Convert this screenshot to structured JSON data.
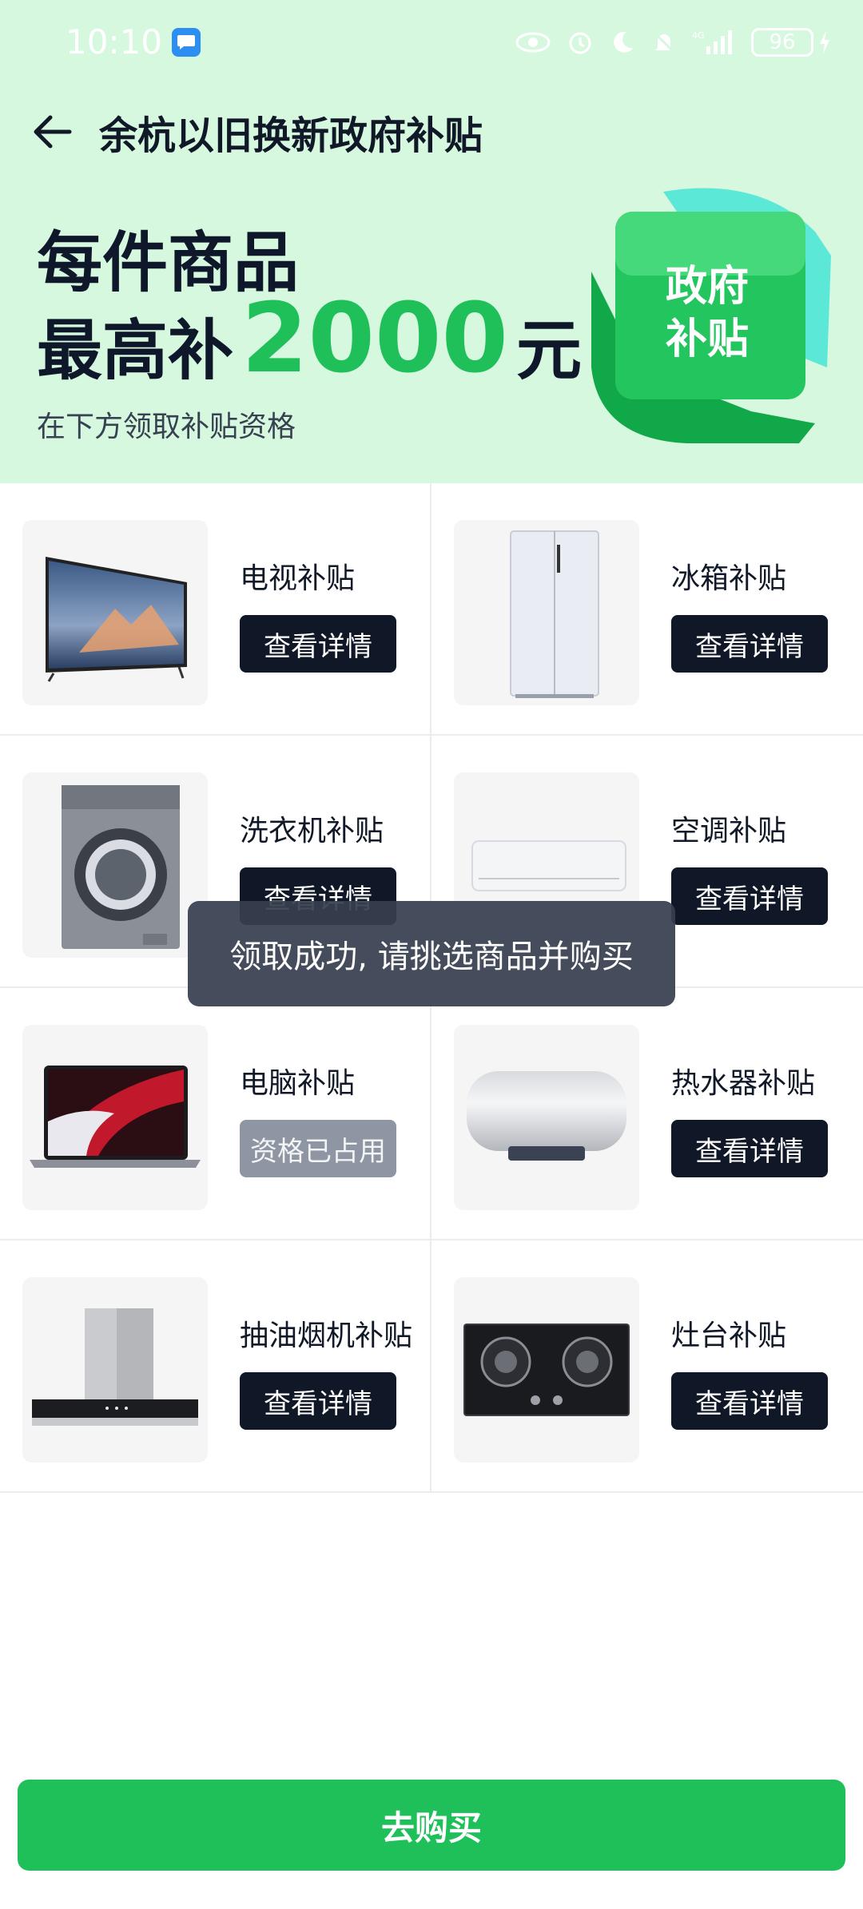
{
  "status_bar": {
    "time": "10:10",
    "network": "4G",
    "battery": "96"
  },
  "header": {
    "title": "余杭以旧换新政府补贴"
  },
  "hero": {
    "line1": "每件商品",
    "line2_prefix": "最高补",
    "amount": "2000",
    "line2_suffix": "元",
    "subtitle": "在下方领取补贴资格",
    "badge_line1": "政府",
    "badge_line2": "补贴"
  },
  "items": [
    {
      "name": "电视补贴",
      "button": "查看详情",
      "state": "active",
      "icon": "tv"
    },
    {
      "name": "冰箱补贴",
      "button": "查看详情",
      "state": "active",
      "icon": "fridge"
    },
    {
      "name": "洗衣机补贴",
      "button": "查看详情",
      "state": "active",
      "icon": "washing-machine"
    },
    {
      "name": "空调补贴",
      "button": "查看详情",
      "state": "active",
      "icon": "air-conditioner"
    },
    {
      "name": "电脑补贴",
      "button": "资格已占用",
      "state": "disabled",
      "icon": "laptop"
    },
    {
      "name": "热水器补贴",
      "button": "查看详情",
      "state": "active",
      "icon": "water-heater"
    },
    {
      "name": "抽油烟机补贴",
      "button": "查看详情",
      "state": "active",
      "icon": "range-hood"
    },
    {
      "name": "灶台补贴",
      "button": "查看详情",
      "state": "active",
      "icon": "gas-stove"
    }
  ],
  "toast": "领取成功, 请挑选商品并购买",
  "cta": "去购买",
  "colors": {
    "hero_bg": "#d6f8df",
    "accent_green": "#1fbf5a",
    "button_dark": "#101828",
    "button_disabled": "#8e96a3"
  }
}
